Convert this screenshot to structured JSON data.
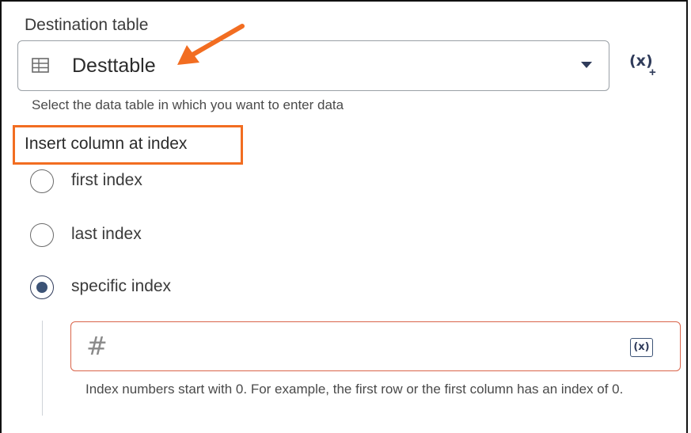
{
  "destination": {
    "label": "Destination table",
    "value": "Desttable",
    "hint": "Select the data table in which you want to enter data",
    "variable_button": "(x)",
    "variable_plus": "+"
  },
  "insert_column": {
    "title": "Insert column at index",
    "options": [
      {
        "label": "first index",
        "checked": false
      },
      {
        "label": "last index",
        "checked": false
      },
      {
        "label": "specific index",
        "checked": true
      }
    ],
    "index_input": {
      "value": "",
      "icon": "hash-icon",
      "variable_button": "(x)",
      "hint": "Index numbers start with 0. For example, the first row or the first column has an index of 0."
    }
  },
  "annotations": {
    "highlight_color": "#f26d21"
  }
}
